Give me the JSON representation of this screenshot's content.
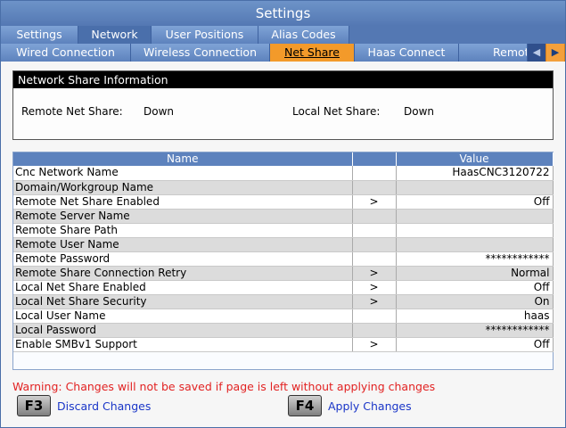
{
  "window": {
    "title": "Settings"
  },
  "tabs_top": [
    {
      "label": "Settings",
      "active": false
    },
    {
      "label": "Network",
      "active": true
    },
    {
      "label": "User Positions",
      "active": false
    },
    {
      "label": "Alias Codes",
      "active": false
    }
  ],
  "tabs_sub": [
    {
      "label": "Wired Connection",
      "active": false
    },
    {
      "label": "Wireless Connection",
      "active": false
    },
    {
      "label": "Net Share",
      "active": true
    },
    {
      "label": "Haas Connect",
      "active": false
    },
    {
      "label": "Remote",
      "active": false
    }
  ],
  "info_panel": {
    "title": "Network Share Information",
    "remote_label": "Remote Net Share:",
    "remote_value": "Down",
    "local_label": "Local Net Share:",
    "local_value": "Down"
  },
  "table": {
    "headers": [
      "Name",
      "",
      "Value"
    ],
    "rows": [
      {
        "name": "Cnc Network Name",
        "arrow": "",
        "value": "HaasCNC3120722"
      },
      {
        "name": "Domain/Workgroup Name",
        "arrow": "",
        "value": ""
      },
      {
        "name": "Remote Net Share Enabled",
        "arrow": ">",
        "value": "Off"
      },
      {
        "name": "Remote Server Name",
        "arrow": "",
        "value": ""
      },
      {
        "name": "Remote Share Path",
        "arrow": "",
        "value": ""
      },
      {
        "name": "Remote User Name",
        "arrow": "",
        "value": ""
      },
      {
        "name": "Remote Password",
        "arrow": "",
        "value": "************"
      },
      {
        "name": "Remote Share Connection Retry",
        "arrow": ">",
        "value": "Normal"
      },
      {
        "name": "Local Net Share Enabled",
        "arrow": ">",
        "value": "Off"
      },
      {
        "name": "Local Net Share Security",
        "arrow": ">",
        "value": "On"
      },
      {
        "name": "Local User Name",
        "arrow": "",
        "value": "haas"
      },
      {
        "name": "Local Password",
        "arrow": "",
        "value": "************"
      },
      {
        "name": "Enable SMBv1 Support",
        "arrow": ">",
        "value": "Off"
      }
    ]
  },
  "warning": "Warning: Changes will not be saved if page is left without applying changes",
  "actions": {
    "discard_key": "F3",
    "discard_label": "Discard Changes",
    "apply_key": "F4",
    "apply_label": "Apply Changes"
  },
  "colors": {
    "accent": "#5478b3",
    "active_tab": "#f39a2a",
    "warning": "#e22222",
    "link": "#1a36c8"
  },
  "icons": {
    "scroll_left": "triangle-left-icon",
    "scroll_right": "triangle-right-icon"
  }
}
